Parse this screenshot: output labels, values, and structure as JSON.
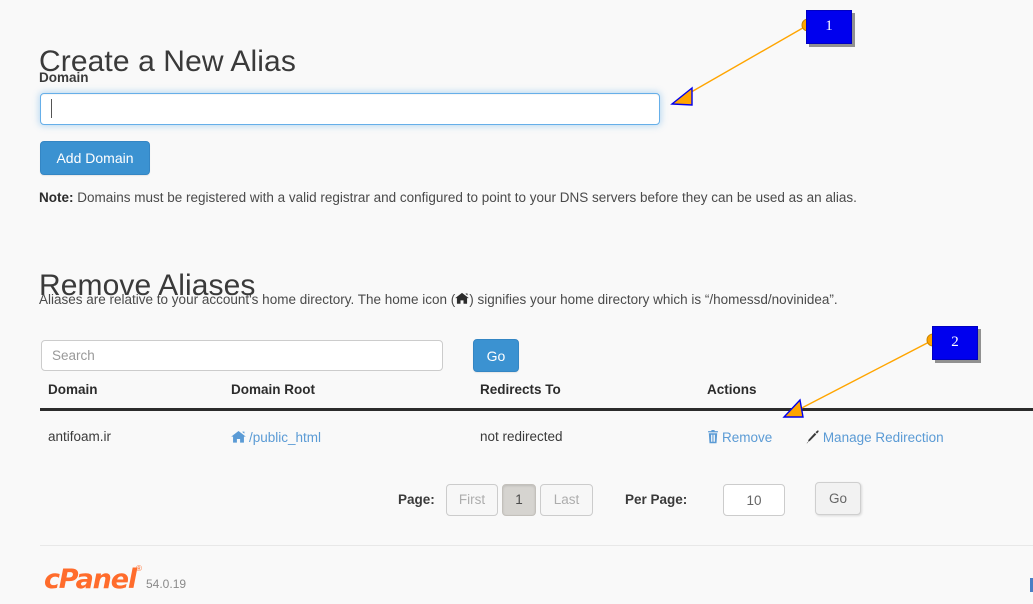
{
  "create_section": {
    "title": "Create a New Alias",
    "domain_label": "Domain",
    "domain_value": "",
    "domain_placeholder": "",
    "add_button": "Add Domain",
    "note_prefix": "Note:",
    "note_text": " Domains must be registered with a valid registrar and configured to point to your DNS servers before they can be used as an alias."
  },
  "remove_section": {
    "title": "Remove Aliases",
    "description_before": "Aliases are relative to your account's home directory. The home icon (",
    "home_icon": "home-icon",
    "description_after": ") signifies your home directory which is “/homessd/novinidea”.",
    "search_placeholder": "Search",
    "search_value": "",
    "search_go_label": "Go"
  },
  "table": {
    "headers": [
      "Domain",
      "Domain Root",
      "Redirects To",
      "Actions"
    ],
    "rows": [
      {
        "domain": "antifoam.ir",
        "domain_root": "/public_html",
        "domain_root_icon": "home-icon",
        "redirects_to": "not redirected",
        "actions": [
          {
            "label": "Remove",
            "icon": "trash-icon"
          },
          {
            "label": "Manage Redirection",
            "icon": "pencil-icon"
          }
        ]
      }
    ]
  },
  "pagination": {
    "page_label": "Page:",
    "first_label": "First",
    "current_page": "1",
    "last_label": "Last",
    "per_page_label": "Per Page:",
    "per_page_value": "10",
    "go_label": "Go"
  },
  "footer": {
    "logo_text": "cPanel",
    "registered_mark": "®",
    "version": "54.0.19"
  },
  "annotations": [
    {
      "number": "1"
    },
    {
      "number": "2"
    }
  ],
  "colors": {
    "primary_button": "#3b92d1",
    "link": "#5b9bd5",
    "focus_border": "#66afe9",
    "brand_orange": "#ff6c2c",
    "annotation_badge": "#0000ee",
    "annotation_line": "#ffa500",
    "page_background": "#f9f9f9"
  }
}
